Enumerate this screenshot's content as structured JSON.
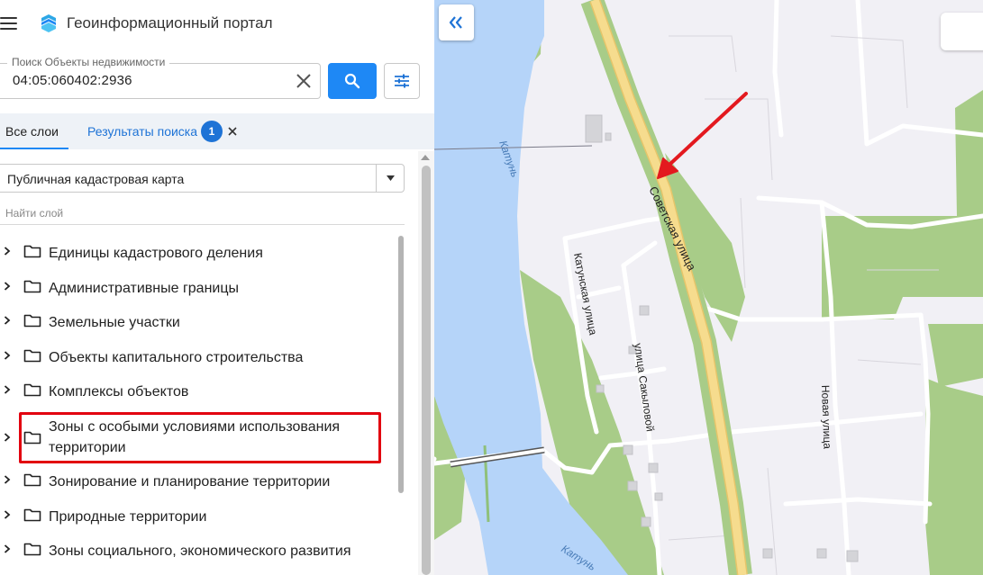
{
  "header": {
    "title": "Геоинформационный портал",
    "menu_icon": "hamburger-menu-icon",
    "logo_icon": "portal-logo-icon"
  },
  "search": {
    "legend": "Поиск Объекты недвижимости",
    "value": "04:05:060402:2936",
    "clear_icon": "close-icon",
    "search_icon": "search-icon",
    "filter_icon": "filter-sliders-icon",
    "accent_color": "#1e88f5"
  },
  "tabs": {
    "all_layers": "Все слои",
    "results": "Результаты поиска",
    "results_count": "1"
  },
  "basemap": {
    "selected": "Публичная кадастровая карта"
  },
  "layer_search": {
    "placeholder": "Найти слой"
  },
  "layers": [
    "Единицы кадастрового деления",
    "Административные границы",
    "Земельные участки",
    "Объекты капитального строительства",
    "Комплексы объектов",
    "Зоны с особыми условиями использования территории",
    "Зонирование и планирование территории",
    "Природные территории",
    "Зоны социального, экономического развития"
  ],
  "highlight": {
    "layer": "Зоны с особыми условиями использования территории",
    "color": "#e2000f"
  },
  "map": {
    "streets": {
      "sovetskaya": "Советская улица",
      "katunskaya": "Катунская улица",
      "sakylovoy": "улица Сакыловой",
      "novaya": "Новая улица"
    },
    "river": "Катунь",
    "colors": {
      "land": "#f1f0f5",
      "water": "#b5d4f9",
      "green": "#a8cc88",
      "main_road": "#f6dc8e",
      "arrow": "#e3191f"
    },
    "collapse_icon": "double-chevron-left-icon"
  }
}
